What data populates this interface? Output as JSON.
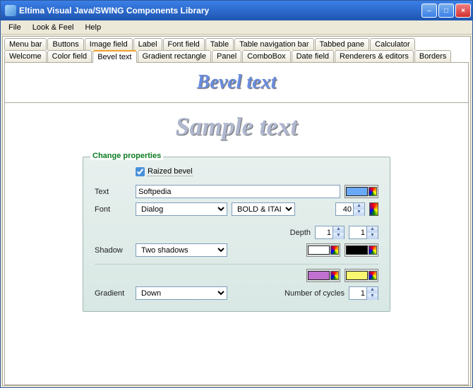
{
  "window": {
    "title": "Eltima Visual Java/SWING Components Library"
  },
  "menu": {
    "file": "File",
    "lookfeel": "Look & Feel",
    "help": "Help"
  },
  "tabs_row1": [
    {
      "label": "Menu bar"
    },
    {
      "label": "Buttons"
    },
    {
      "label": "Image field"
    },
    {
      "label": "Label"
    },
    {
      "label": "Font field"
    },
    {
      "label": "Table"
    },
    {
      "label": "Table navigation bar"
    },
    {
      "label": "Tabbed pane"
    },
    {
      "label": "Calculator"
    }
  ],
  "tabs_row2": [
    {
      "label": "Welcome"
    },
    {
      "label": "Color field"
    },
    {
      "label": "Bevel text",
      "active": true
    },
    {
      "label": "Gradient rectangle"
    },
    {
      "label": "Panel"
    },
    {
      "label": "ComboBox"
    },
    {
      "label": "Date field"
    },
    {
      "label": "Renderers & editors"
    },
    {
      "label": "Borders"
    }
  ],
  "content": {
    "heading": "Bevel text",
    "sample": "Sample text",
    "panel_title": "Change properties",
    "raized_label": "Raized bevel",
    "raized_checked": true,
    "labels": {
      "text": "Text",
      "font": "Font",
      "shadow": "Shadow",
      "gradient": "Gradient",
      "depth": "Depth",
      "cycles": "Number of cycles"
    },
    "text_value": "Softpedia",
    "font_name": "Dialog",
    "font_style": "BOLD & ITALIC",
    "font_size": "40",
    "shadow_sel": "Two shadows",
    "gradient_sel": "Down",
    "depth1": "1",
    "depth2": "1",
    "cycles": "1",
    "colors": {
      "text": "#6aa8f8",
      "shadow1": "#ffffff",
      "shadow2": "#000000",
      "grad1": "#c070d0",
      "grad2": "#f8f870"
    }
  }
}
